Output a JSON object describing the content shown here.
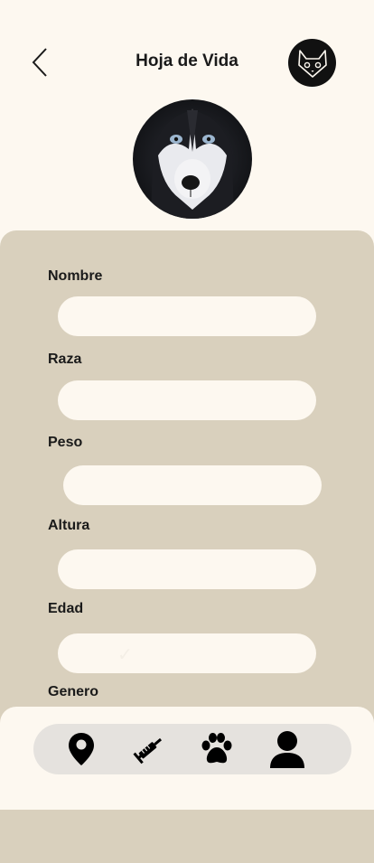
{
  "header": {
    "title": "Hoja de Vida",
    "back_icon": "chevron-left-icon",
    "logo_icon": "cat-face-icon"
  },
  "profile": {
    "photo": "husky-dog-photo"
  },
  "form": {
    "fields": [
      {
        "label": "Nombre",
        "value": ""
      },
      {
        "label": "Raza",
        "value": ""
      },
      {
        "label": "Peso",
        "value": ""
      },
      {
        "label": "Altura",
        "value": ""
      },
      {
        "label": "Edad",
        "value": ""
      },
      {
        "label": "Genero",
        "value": ""
      }
    ]
  },
  "nav": {
    "items": [
      {
        "icon": "location-pin-icon"
      },
      {
        "icon": "syringe-icon"
      },
      {
        "icon": "paw-icon"
      },
      {
        "icon": "user-icon"
      }
    ]
  },
  "colors": {
    "background": "#fdf8f0",
    "panel": "#d9d0bd",
    "nav_bar": "#e5e2de",
    "text": "#1a1a1a"
  }
}
